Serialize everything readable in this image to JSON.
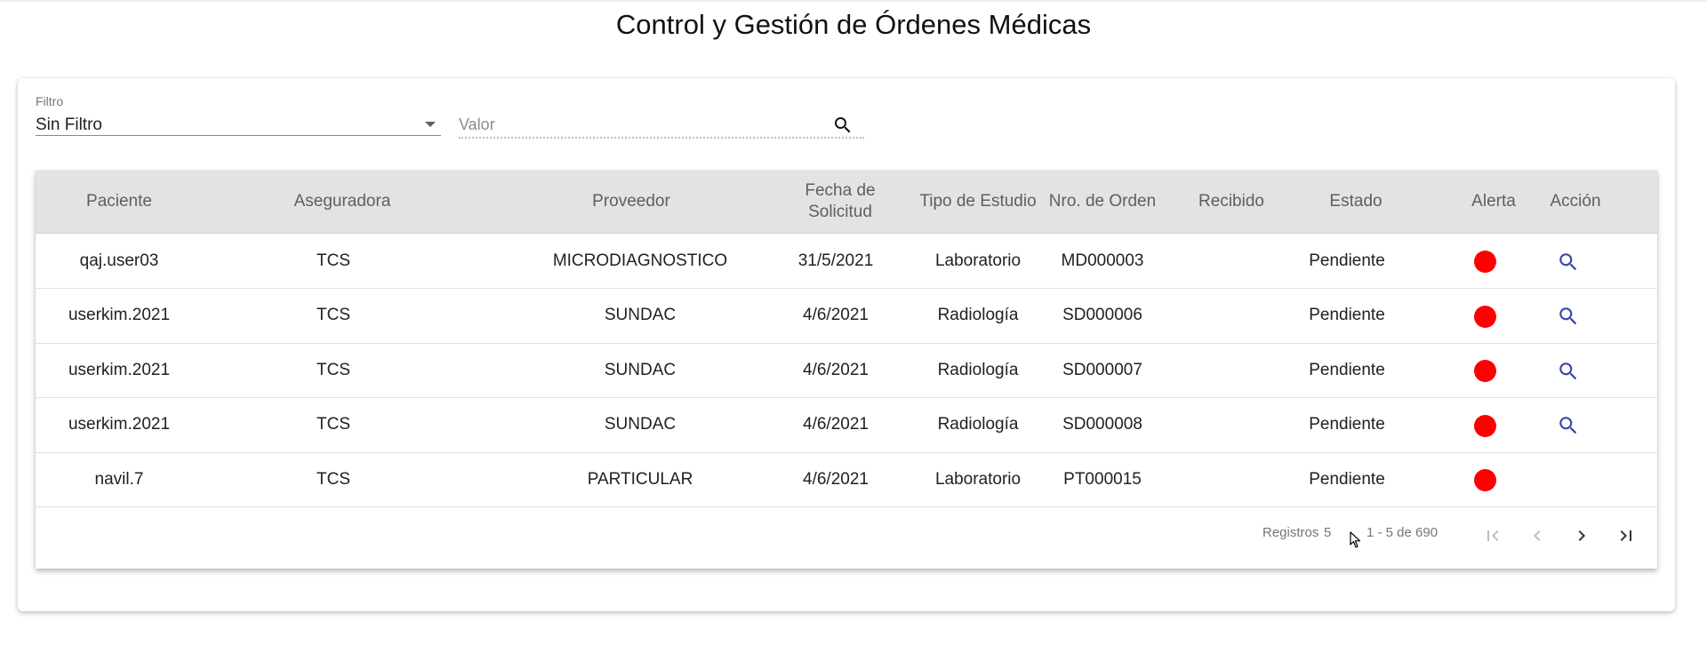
{
  "page": {
    "title": "Control y Gestión de Órdenes Médicas"
  },
  "filter": {
    "label": "Filtro",
    "value": "Sin Filtro",
    "value_placeholder": "Valor"
  },
  "table": {
    "headers": [
      "Paciente",
      "Aseguradora",
      "Proveedor",
      "Fecha de Solicitud",
      "Tipo de Estudio",
      "Nro. de Orden",
      "Recibido",
      "Estado",
      "Alerta",
      "Acción"
    ],
    "rows": [
      {
        "paciente": "qaj.user03",
        "aseguradora": "TCS",
        "proveedor": "MICRODIAGNOSTICO",
        "fecha": "31/5/2021",
        "tipo": "Laboratorio",
        "orden": "MD000003",
        "recibido": "",
        "estado": "Pendiente",
        "alerta": "red",
        "accion": "search-icon"
      },
      {
        "paciente": "userkim.2021",
        "aseguradora": "TCS",
        "proveedor": "SUNDAC",
        "fecha": "4/6/2021",
        "tipo": "Radiología",
        "orden": "SD000006",
        "recibido": "",
        "estado": "Pendiente",
        "alerta": "red",
        "accion": "search-icon"
      },
      {
        "paciente": "userkim.2021",
        "aseguradora": "TCS",
        "proveedor": "SUNDAC",
        "fecha": "4/6/2021",
        "tipo": "Radiología",
        "orden": "SD000007",
        "recibido": "",
        "estado": "Pendiente",
        "alerta": "red",
        "accion": "search-icon"
      },
      {
        "paciente": "userkim.2021",
        "aseguradora": "TCS",
        "proveedor": "SUNDAC",
        "fecha": "4/6/2021",
        "tipo": "Radiología",
        "orden": "SD000008",
        "recibido": "",
        "estado": "Pendiente",
        "alerta": "red",
        "accion": "search-icon"
      },
      {
        "paciente": "navil.7",
        "aseguradora": "TCS",
        "proveedor": "PARTICULAR",
        "fecha": "4/6/2021",
        "tipo": "Laboratorio",
        "orden": "PT000015",
        "recibido": "",
        "estado": "Pendiente",
        "alerta": "red",
        "accion": ""
      }
    ]
  },
  "pagination": {
    "records_label": "Registros",
    "records_value": "5",
    "range_text": "1 - 5 de 690"
  },
  "colors": {
    "alert": "#ff0000",
    "action_icon": "#3949ab",
    "header_bg": "#e3e3e3"
  }
}
